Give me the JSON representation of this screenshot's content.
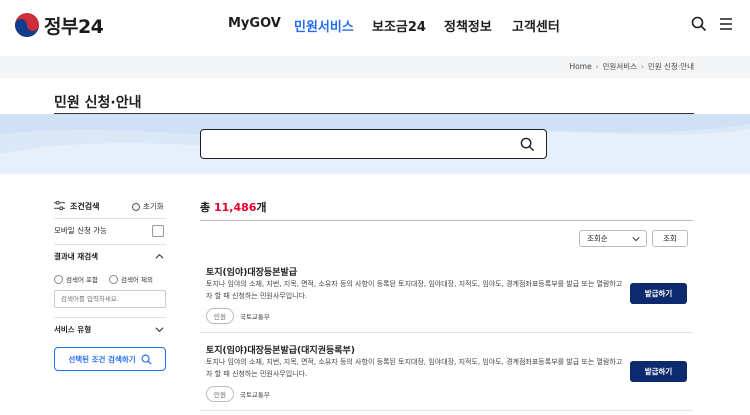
{
  "header": {
    "logo_text": "정부24",
    "nav": [
      {
        "label": "MyGOV",
        "active": false
      },
      {
        "label": "민원서비스",
        "active": true
      },
      {
        "label": "보조금24",
        "active": false
      },
      {
        "label": "정책정보",
        "active": false
      },
      {
        "label": "고객센터",
        "active": false
      }
    ],
    "icons": [
      "search-icon",
      "menu-icon"
    ]
  },
  "breadcrumb": [
    "Home",
    "민원서비스",
    "민원 신청·안내"
  ],
  "page_title": "민원 신청·안내",
  "search": {
    "value": "",
    "placeholder": ""
  },
  "sidebar": {
    "filter_title": "조건검색",
    "reset_label": "초기화",
    "mobile_label": "모바일 신청 가능",
    "result_research_label": "결과내 재검색",
    "include_label": "검색어 포함",
    "exclude_label": "검색어 제외",
    "research_placeholder": "검색어를 입력하세요.",
    "service_type_label": "서비스 유형",
    "apply_label": "선택된 조건 검색하기"
  },
  "results": {
    "total_prefix": "총 ",
    "total_count": "11,486",
    "total_suffix": "개",
    "sort_value": "조회순",
    "query_label": "조회",
    "items": [
      {
        "title": "토지(임야)대장등본발급",
        "desc": "토지나 임야의 소재, 지번, 지목, 면적, 소유자 등의 사항이 등록된 토지대장, 임야대장, 지적도, 임야도, 경계점좌표등록부를 발급 또는 열람하고자 할 때 신청하는 민원사무입니다.",
        "tag": "민원",
        "dept": "국토교통부",
        "button": "발급하기"
      },
      {
        "title": "토지(임야)대장등본발급(대지권등록부)",
        "desc": "토지나 임야의 소재, 지번, 지목, 면적, 소유자 등의 사항이 등록된 토지대장, 임야대장, 지적도, 임야도, 경계점좌표등록부를 발급 또는 열람하고자 할 때 신청하는 민원사무입니다.",
        "tag": "민원",
        "dept": "국토교통부",
        "button": "발급하기"
      }
    ]
  },
  "colors": {
    "accent": "#256ef4",
    "count_red": "#e6002d",
    "navy_button": "#0d2a6e",
    "search_band": "#dbe8f7"
  }
}
